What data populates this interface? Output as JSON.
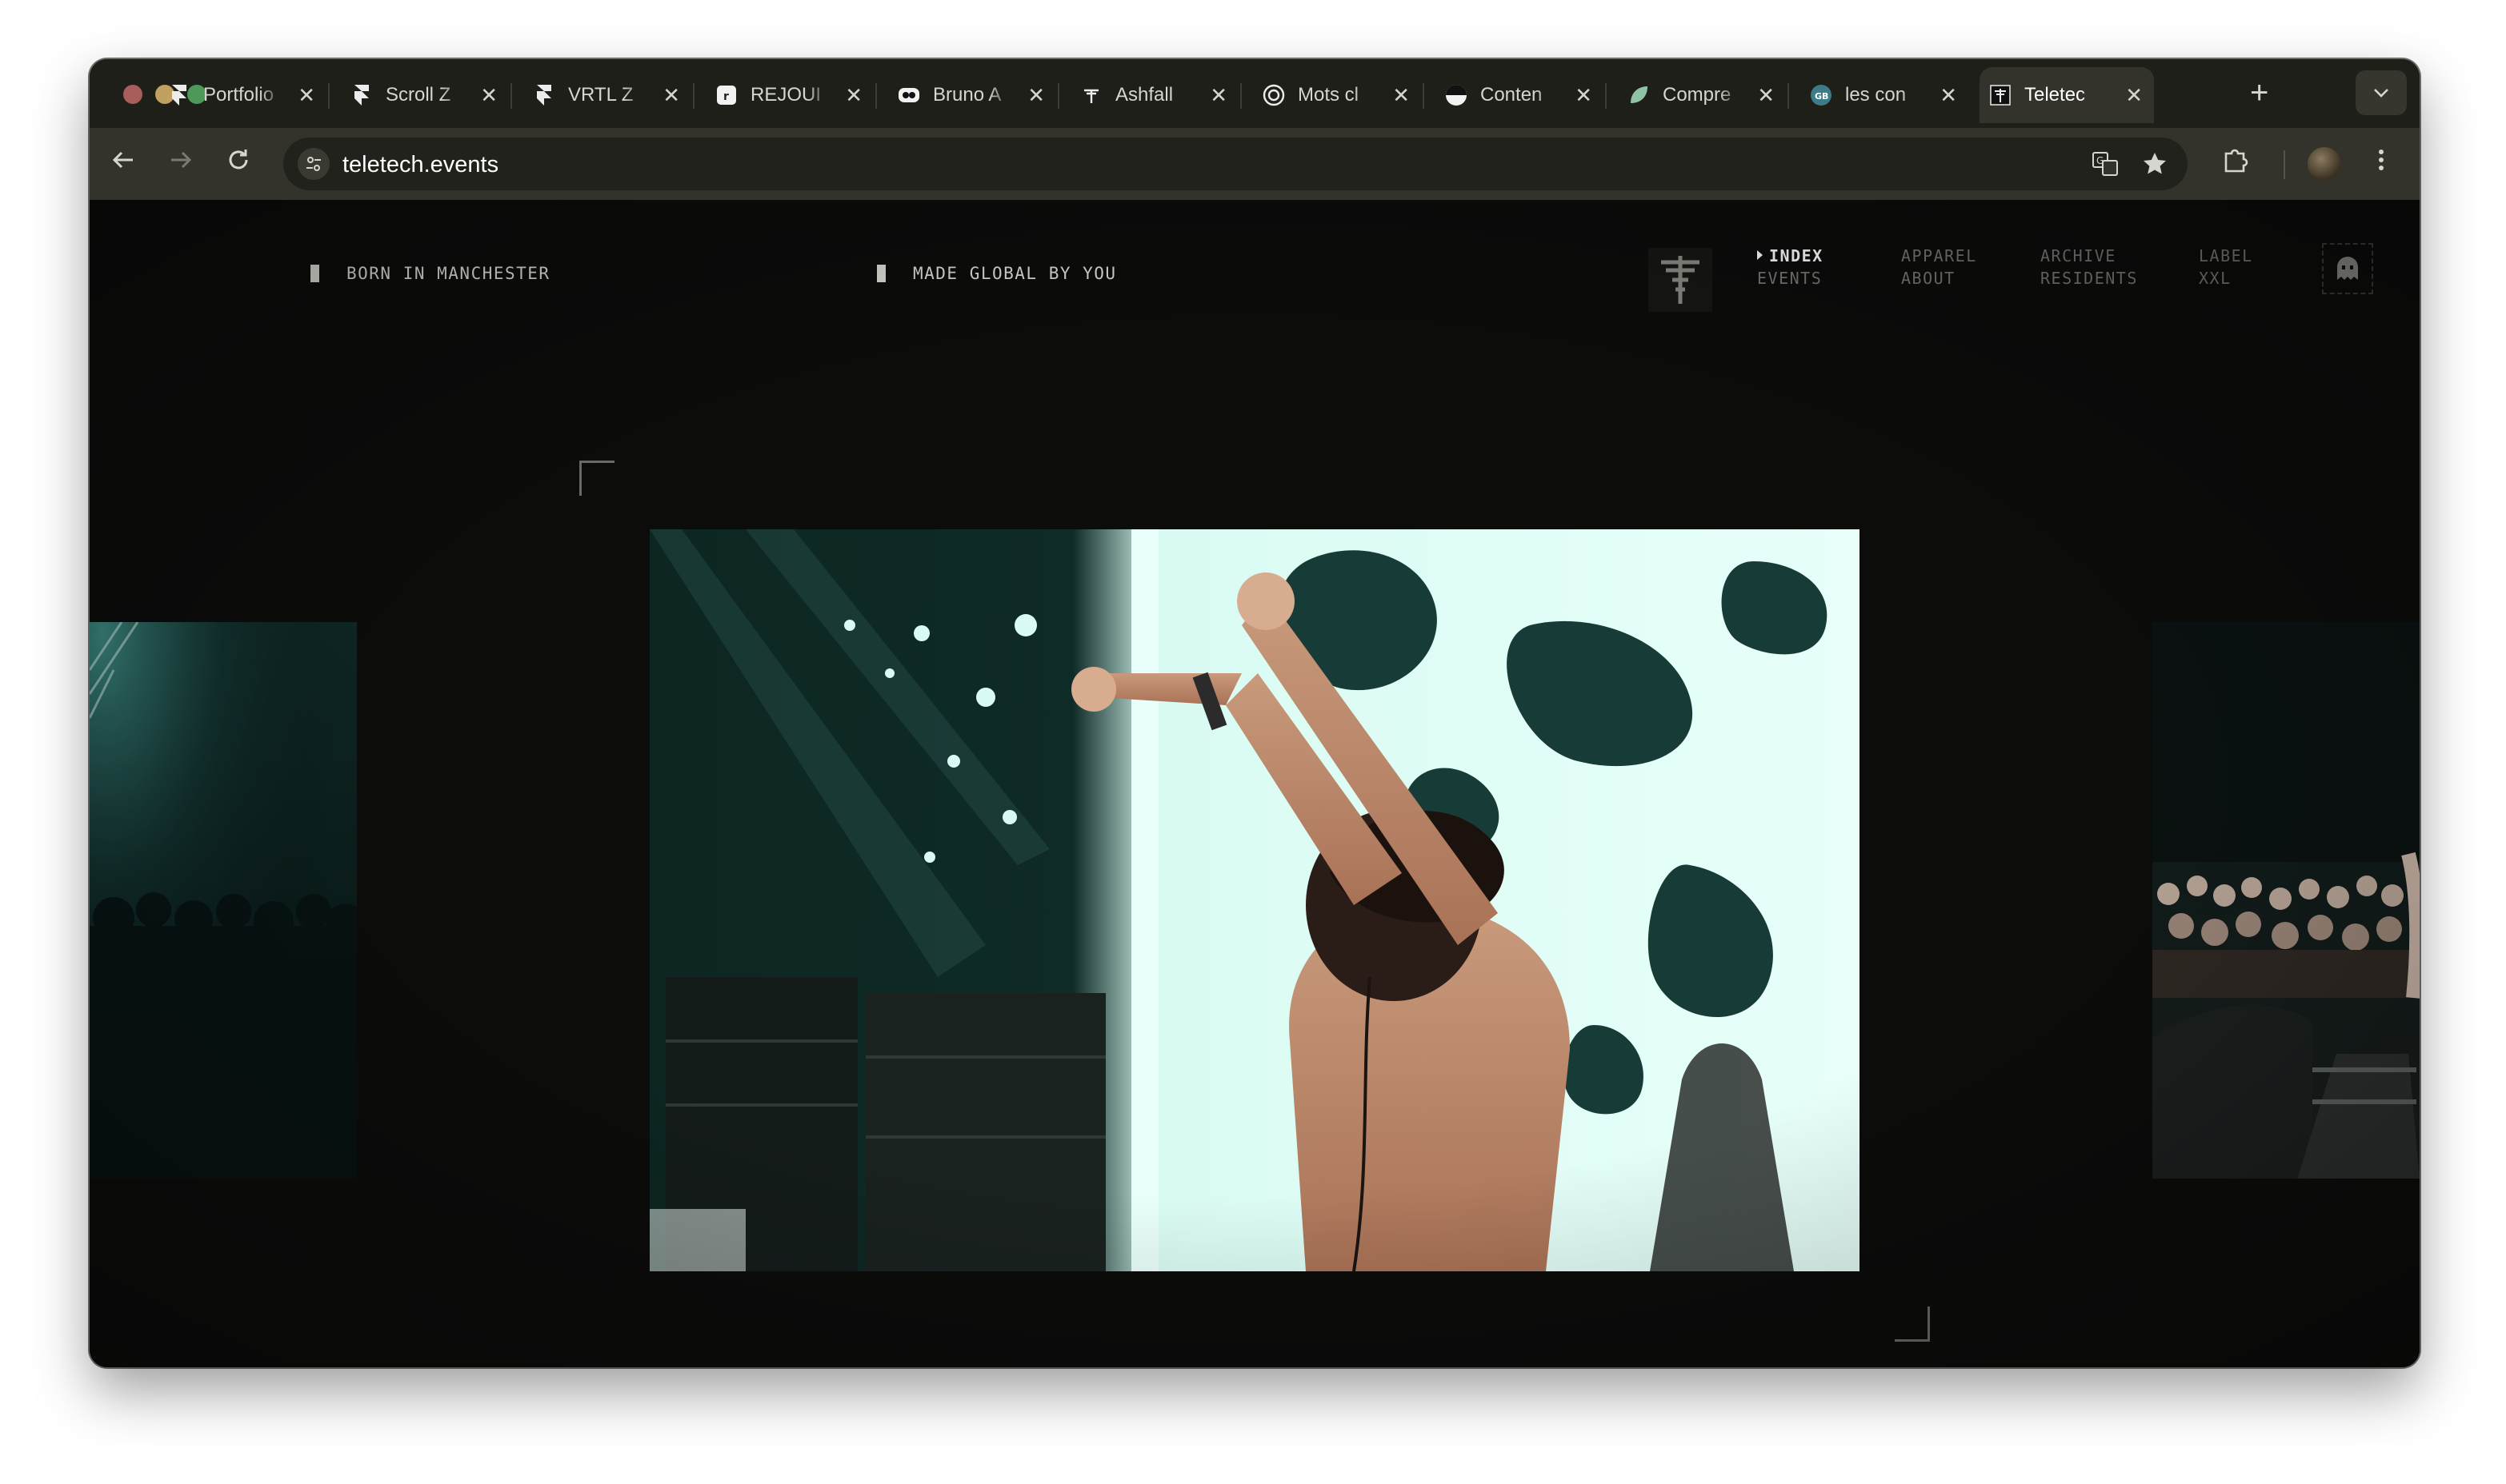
{
  "browser": {
    "tabs": [
      {
        "title": "Portfolio",
        "icon": "framer-icon"
      },
      {
        "title": "Scroll Z",
        "icon": "framer-icon"
      },
      {
        "title": "VRTL Z",
        "icon": "framer-icon"
      },
      {
        "title": "REJOUI",
        "icon": "rejoui-icon"
      },
      {
        "title": "Bruno A",
        "icon": "bruno-icon"
      },
      {
        "title": "Ashfall",
        "icon": "ashfall-icon"
      },
      {
        "title": "Mots cl",
        "icon": "openai-icon"
      },
      {
        "title": "Conten",
        "icon": "content-icon"
      },
      {
        "title": "Compre",
        "icon": "leaf-icon"
      },
      {
        "title": "les con",
        "icon": "gb-icon"
      },
      {
        "title": "Teletec",
        "icon": "teletech-icon",
        "active": true
      }
    ],
    "address": "teletech.events"
  },
  "site": {
    "tagline_left": "BORN IN MANCHESTER",
    "tagline_right": "MADE GLOBAL BY YOU",
    "nav": [
      {
        "top": "INDEX",
        "bottom": "EVENTS",
        "active": true
      },
      {
        "top": "APPAREL",
        "bottom": "ABOUT"
      },
      {
        "top": "ARCHIVE",
        "bottom": "RESIDENTS"
      },
      {
        "top": "LABEL",
        "bottom": "XXL"
      }
    ],
    "colors": {
      "background": "#0c0c0b",
      "nav_inactive": "#777770",
      "nav_active": "#ffffff",
      "photo_teal": "#bff2e6"
    }
  }
}
